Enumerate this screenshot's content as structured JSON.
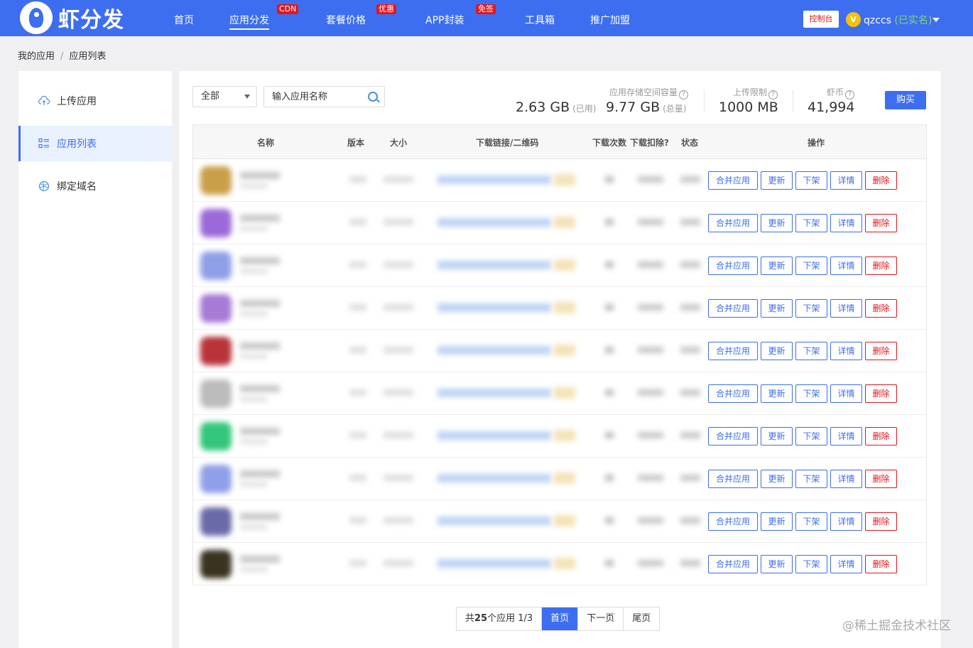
{
  "header": {
    "logo_text": "虾分发",
    "nav": [
      {
        "label": "首页",
        "badge": ""
      },
      {
        "label": "应用分发",
        "badge": "CDN"
      },
      {
        "label": "套餐价格",
        "badge": "优惠"
      },
      {
        "label": "APP封装",
        "badge": "免签"
      },
      {
        "label": "工具箱",
        "badge": ""
      },
      {
        "label": "推广加盟",
        "badge": ""
      }
    ],
    "console_label": "控制台",
    "vip_icon": "V",
    "username": "qzccs",
    "realname_status": "(已实名)"
  },
  "breadcrumb": [
    "我的应用",
    "应用列表"
  ],
  "breadcrumb_sep": "/",
  "sidebar": {
    "items": [
      {
        "label": "上传应用",
        "icon": "cloud-upload-icon"
      },
      {
        "label": "应用列表",
        "icon": "list-icon"
      },
      {
        "label": "绑定域名",
        "icon": "globe-icon"
      }
    ]
  },
  "filter": {
    "selected": "全部",
    "search_placeholder": "输入应用名称"
  },
  "stats": {
    "storage_label": "应用存储空间容量",
    "used_value": "2.63 GB",
    "used_unit": "(已用)",
    "total_value": "9.77 GB",
    "total_unit": "(总量)",
    "upload_limit_label": "上传限制",
    "upload_limit_value": "1000 MB",
    "coins_label": "虾币",
    "coins_value": "41,994",
    "help_glyph": "?",
    "buy_label": "购买"
  },
  "table": {
    "columns": [
      "名称",
      "版本",
      "大小",
      "下载链接/二维码",
      "下载次数",
      "下载扣除?",
      "状态",
      "操作"
    ],
    "actions": {
      "merge": "合并应用",
      "update": "更新",
      "offline": "下架",
      "detail": "详情",
      "delete": "删除"
    },
    "row_count": 10
  },
  "pagination": {
    "total_prefix": "共",
    "total_count": "25",
    "total_suffix": "个应用 1/3",
    "first": "首页",
    "next": "下一页",
    "last": "尾页"
  },
  "watermark": "@稀土掘金技术社区",
  "colors": {
    "accent": "#3d6ef0",
    "danger": "#e4151a",
    "verified": "#7dd96b"
  }
}
